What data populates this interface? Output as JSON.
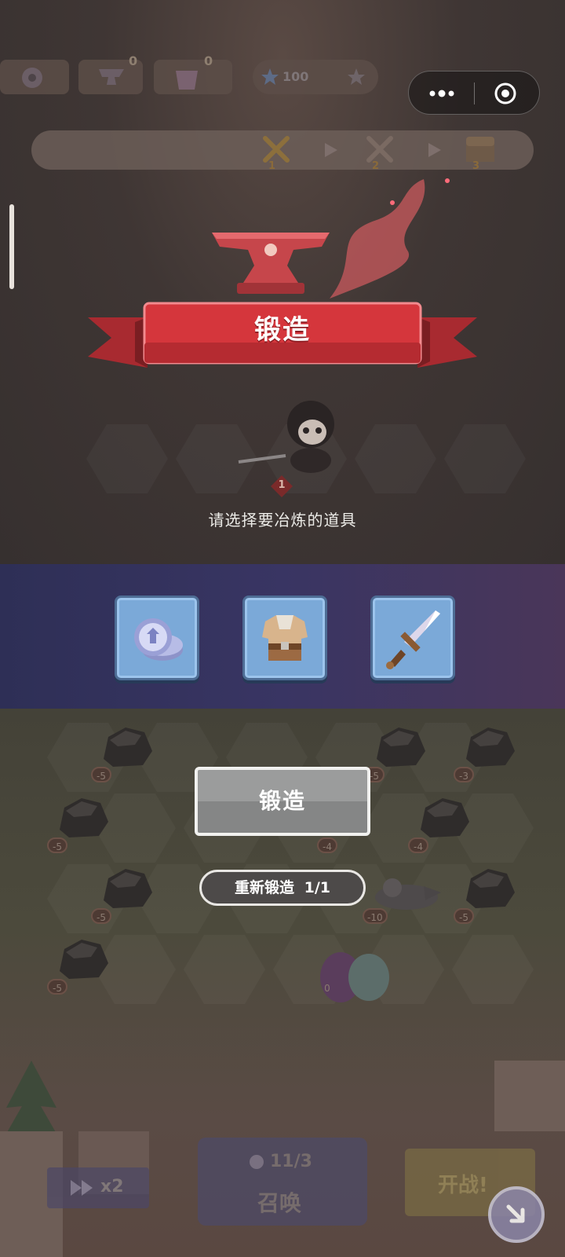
{
  "hud": {
    "anvil_count": "0",
    "potion_count": "0",
    "stars": "100"
  },
  "stages": [
    "1",
    "2",
    "3"
  ],
  "forge": {
    "title": "锻造",
    "hero_level": "1",
    "prompt": "请选择要冶炼的道具"
  },
  "choices": [
    {
      "name": "coins",
      "icon": "coin-stack-icon"
    },
    {
      "name": "armor",
      "icon": "armor-vest-icon"
    },
    {
      "name": "sword",
      "icon": "sword-icon"
    }
  ],
  "forge_button": {
    "label": "锻造"
  },
  "reforge_button": {
    "label": "重新锻造",
    "count": "1/1"
  },
  "board_badges": [
    "-5",
    "-5",
    "-3",
    "-5",
    "-4",
    "-4",
    "-5",
    "-10",
    "-5",
    "-5",
    "0"
  ],
  "bottom": {
    "summon_cost": "11/3",
    "summon_label": "召唤",
    "start_label": "开战!",
    "speed_label": "x2"
  },
  "colors": {
    "ribbon_red": "#d5363c",
    "card_blue": "#7ba9d8",
    "button_gray": "#9b9c9c"
  }
}
